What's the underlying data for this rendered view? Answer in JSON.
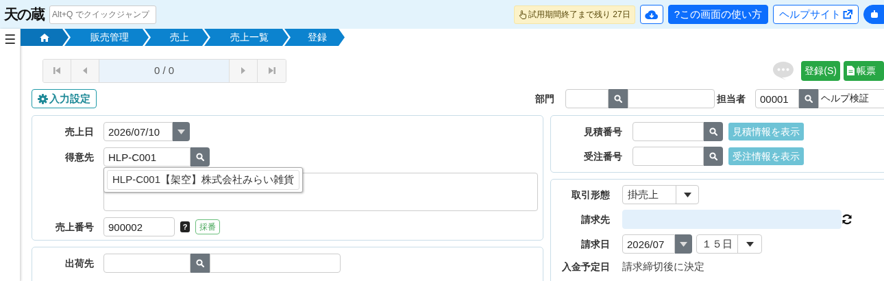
{
  "menu_glyph": "☰",
  "header": {
    "logo": "天の蔵",
    "quick_jump": {
      "placeholder": "Alt+Q でクイックジャンプ"
    },
    "trial_notice": "試用期間終了まで残り 27日",
    "buttons": [
      {
        "kind": "download"
      },
      {
        "kind": "primary",
        "label": "?この画面の使い方"
      },
      {
        "kind": "outline",
        "label": "ヘルプサイト"
      },
      {
        "kind": "robot"
      }
    ]
  },
  "breadcrumb": [
    {
      "kind": "home"
    },
    {
      "kind": "text",
      "label": "販売管理"
    },
    {
      "kind": "text",
      "label": "売上"
    },
    {
      "kind": "text",
      "label": "売上一覧"
    },
    {
      "kind": "text",
      "label": "登録"
    }
  ],
  "pager": {
    "position": "0 / 0"
  },
  "actions": [
    {
      "kind": "save",
      "label": "登録(S)"
    },
    {
      "kind": "report",
      "label": "帳票"
    }
  ],
  "input_settings": "入力設定",
  "department": {
    "label": "部門"
  },
  "staff": {
    "label": "担当者",
    "code": "00001",
    "name": "ヘルプ検証"
  },
  "sales_form": {
    "sales_date": {
      "label": "売上日",
      "value": "2026/07/10"
    },
    "customer": {
      "label": "得意先",
      "value": "HLP-C001",
      "suggestion": "HLP-C001【架空】株式会社みらい雑貨"
    },
    "sales_number": {
      "label": "売上番号",
      "value": "900002",
      "help": "?",
      "assign_button": "採番"
    }
  },
  "shipping": {
    "label": "出荷先"
  },
  "references": [
    {
      "label": "見積番号",
      "button": "見積情報を表示"
    },
    {
      "label": "受注番号",
      "button": "受注情報を表示"
    }
  ],
  "billing": {
    "transaction_type": {
      "label": "取引形態",
      "value": "掛売上"
    },
    "bill_to": {
      "label": "請求先"
    },
    "billing_date": {
      "label": "請求日",
      "month": "2026/07",
      "day": "１５日"
    },
    "payment_due": {
      "label": "入金予定日",
      "value": "請求締切後に決定"
    }
  }
}
